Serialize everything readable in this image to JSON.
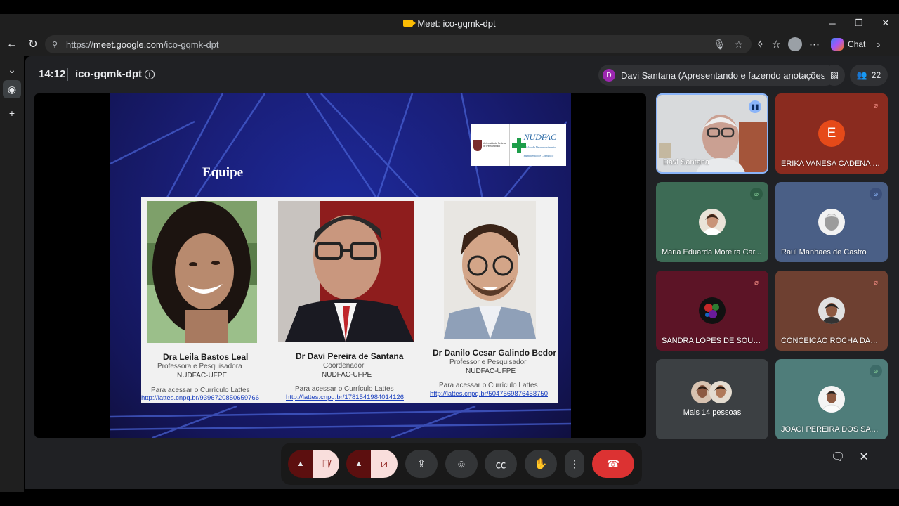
{
  "window": {
    "title": "Meet: ico-gqmk-dpt",
    "controls": {
      "minimize": "─",
      "restore": "❐",
      "close": "✕"
    }
  },
  "browser": {
    "url_scheme": "https://",
    "url_host": "meet.google.com",
    "url_path": "/ico-gqmk-dpt",
    "chat_label": "Chat"
  },
  "meeting": {
    "time": "14:12",
    "code": "ico-gqmk-dpt",
    "presenter_initial": "D",
    "presenter_label": "Davi Santana (Apresentando e fazendo anotações)",
    "participant_count": "22"
  },
  "slide": {
    "title": "Equipe",
    "logo_left_text": "Universidade Federal de Pernambuco",
    "logo_right_text": "NUDFAC",
    "logo_right_sub": "Núcleo de Desenvolvimento Farmacêutico e Cosmético",
    "members": [
      {
        "name": "Dra Leila Bastos Leal",
        "role": "Professora e Pesquisadora",
        "inst": "NUDFAC-UFPE",
        "access": "Para acessar o Currículo Lattes",
        "link": "http://lattes.cnpq.br/9396720850659766"
      },
      {
        "name": "Dr Davi Pereira de Santana",
        "role": "Coordenador",
        "inst": "NUDFAC-UFPE",
        "access": "Para acessar o Currículo Lattes",
        "link": "http://lattes.cnpq.br/1781541984014126"
      },
      {
        "name": "Dr Danilo Cesar Galindo Bedor",
        "role": "Professor e Pesquisador",
        "inst": "NUDFAC-UFPE",
        "access": "Para acessar o Currículo Lattes",
        "link": "http://lattes.cnpq.br/5047569876458750"
      }
    ]
  },
  "participants": [
    {
      "name": "Davi Santana",
      "bg": "#cfd2d4",
      "status": "speaking"
    },
    {
      "name": "ERIKA VANESA CADENA B...",
      "bg": "#8a2b1f",
      "status": "muted",
      "initial": "E"
    },
    {
      "name": "Maria Eduarda Moreira Car...",
      "bg": "#3d6b55",
      "status": "muted-green"
    },
    {
      "name": "Raul Manhaes de Castro",
      "bg": "#4a5f86",
      "status": "muted-blue"
    },
    {
      "name": "SANDRA LOPES DE SOUZA",
      "bg": "#5c1426",
      "status": "muted"
    },
    {
      "name": "CONCEICAO ROCHA DAM...",
      "bg": "#6e4031",
      "status": "muted"
    },
    {
      "name": "Mais 14 pessoas",
      "bg": "#3c4043",
      "status": ""
    },
    {
      "name": "JOACI PEREIRA DOS SAN...",
      "bg": "#4f7d7a",
      "status": "muted-green"
    }
  ]
}
